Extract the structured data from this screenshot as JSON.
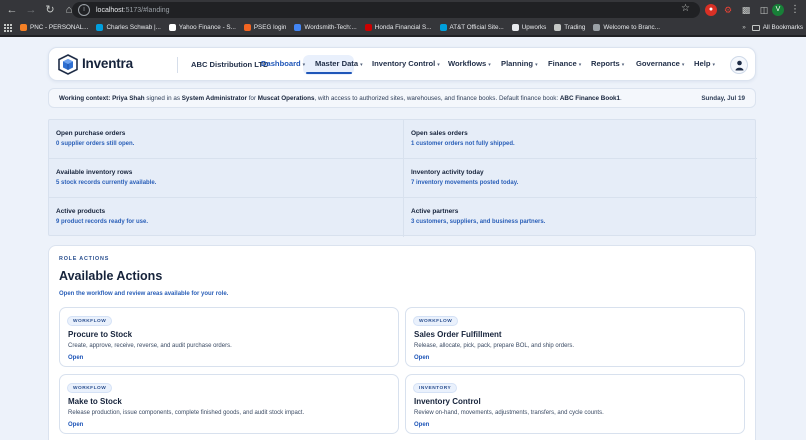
{
  "browser": {
    "url_host": "localhost",
    "url_path": ":5173/#landing",
    "bookmarks": [
      {
        "label": "PNC - PERSONAL...",
        "color": "#f58025"
      },
      {
        "label": "Charles Schwab |...",
        "color": "#00a0df"
      },
      {
        "label": "Yahoo Finance - S...",
        "color": "#ffffff"
      },
      {
        "label": "PSEG login",
        "color": "#f26522"
      },
      {
        "label": "Wordsmith-Tech:...",
        "color": "#4285f4"
      },
      {
        "label": "Honda Financial S...",
        "color": "#cc0000"
      },
      {
        "label": "AT&T Official Site...",
        "color": "#009fdb"
      },
      {
        "label": "Upworks",
        "color": "#e8eaed"
      },
      {
        "label": "Trading",
        "color": "#c4c7c5"
      },
      {
        "label": "Welcome to Branc...",
        "color": "#9aa0a6"
      }
    ],
    "more": "»",
    "all_bookmarks": "All Bookmarks",
    "ext_profile": "V"
  },
  "header": {
    "brand": "Inventra",
    "company": "ABC Distribution LTD",
    "nav": [
      {
        "label": "Dashboard",
        "active": true
      },
      {
        "label": "Master Data"
      },
      {
        "label": "Inventory Control"
      },
      {
        "label": "Workflows"
      },
      {
        "label": "Planning"
      },
      {
        "label": "Finance"
      },
      {
        "label": "Reports"
      },
      {
        "label": "Governance"
      },
      {
        "label": "Help"
      }
    ]
  },
  "context": {
    "prefix": "Working context:",
    "user": "Priya Shah",
    "signed_in_as": "signed in as",
    "role": "System Administrator",
    "for": "for",
    "location": "Muscat Operations",
    "access": ", with access to authorized sites, warehouses, and finance books. Default finance book:",
    "book": "ABC Finance Book1",
    "period": ".",
    "date": "Sunday, Jul 19"
  },
  "stats": [
    {
      "title": "Open purchase orders",
      "desc": "0 supplier orders still open."
    },
    {
      "title": "Open sales orders",
      "desc": "1 customer orders not fully shipped."
    },
    {
      "title": "Available inventory rows",
      "desc": "5 stock records currently available."
    },
    {
      "title": "Inventory activity today",
      "desc": "7 inventory movements posted today."
    },
    {
      "title": "Active products",
      "desc": "9 product records ready for use."
    },
    {
      "title": "Active partners",
      "desc": "3 customers, suppliers, and business partners."
    }
  ],
  "actions": {
    "label": "ROLE ACTIONS",
    "title": "Available Actions",
    "subtitle": "Open the workflow and review areas available for your role.",
    "cards": [
      {
        "badge": "WORKFLOW",
        "title": "Procure to Stock",
        "desc": "Create, approve, receive, reverse, and audit purchase orders.",
        "link": "Open"
      },
      {
        "badge": "WORKFLOW",
        "title": "Sales Order Fulfillment",
        "desc": "Release, allocate, pick, pack, prepare BOL, and ship orders.",
        "link": "Open"
      },
      {
        "badge": "WORKFLOW",
        "title": "Make to Stock",
        "desc": "Release production, issue components, complete finished goods, and audit stock impact.",
        "link": "Open"
      },
      {
        "badge": "INVENTORY",
        "title": "Inventory Control",
        "desc": "Review on-hand, movements, adjustments, transfers, and cycle counts.",
        "link": "Open"
      }
    ]
  }
}
